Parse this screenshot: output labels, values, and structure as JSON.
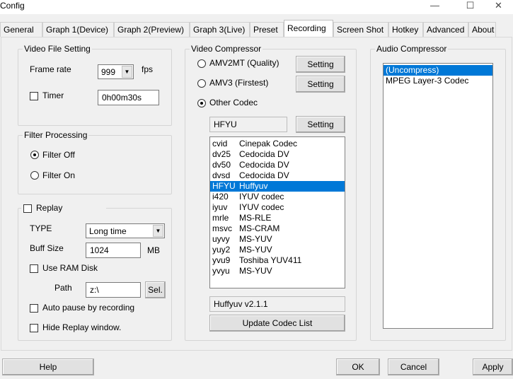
{
  "window": {
    "title": "Config",
    "minimize": "—",
    "maximize": "☐",
    "close": "✕"
  },
  "tabs": [
    "General",
    "Graph 1(Device)",
    "Graph 2(Preview)",
    "Graph 3(Live)",
    "Preset",
    "Recording",
    "Screen Shot",
    "Hotkey",
    "Advanced",
    "About"
  ],
  "active_tab": "Recording",
  "video_file": {
    "group_label": "Video File Setting",
    "frame_rate_label": "Frame rate",
    "frame_rate_value": "999",
    "fps_label": "fps",
    "timer_label": "Timer",
    "timer_checked": false,
    "timer_value": "0h00m30s"
  },
  "filter": {
    "group_label": "Filter Processing",
    "off_label": "Filter Off",
    "on_label": "Filter On",
    "selected": "off"
  },
  "replay": {
    "group_label": "Replay",
    "checked": false,
    "type_label": "TYPE",
    "type_value": "Long time",
    "buff_label": "Buff Size",
    "buff_value": "1024",
    "buff_unit": "MB",
    "ramdisk_label": "Use RAM Disk",
    "path_label": "Path",
    "path_value": "z:\\",
    "sel_label": "Sel.",
    "autopause_label": "Auto pause by recording",
    "hide_label": "Hide Replay window."
  },
  "video_compressor": {
    "group_label": "Video Compressor",
    "options": [
      "AMV2MT (Quality)",
      "AMV3 (Firstest)",
      "Other Codec"
    ],
    "selected_index": 2,
    "setting_label": "Setting",
    "codec_field": "HFYU",
    "codecs": [
      {
        "code": "cvid",
        "name": "Cinepak Codec"
      },
      {
        "code": "dv25",
        "name": "Cedocida DV"
      },
      {
        "code": "dv50",
        "name": "Cedocida DV"
      },
      {
        "code": "dvsd",
        "name": "Cedocida DV"
      },
      {
        "code": "HFYU",
        "name": "Huffyuv"
      },
      {
        "code": "i420",
        "name": "IYUV codec"
      },
      {
        "code": "iyuv",
        "name": "IYUV codec"
      },
      {
        "code": "mrle",
        "name": "MS-RLE"
      },
      {
        "code": "msvc",
        "name": "MS-CRAM"
      },
      {
        "code": "uyvy",
        "name": "MS-YUV"
      },
      {
        "code": "yuy2",
        "name": "MS-YUV"
      },
      {
        "code": "yvu9",
        "name": "Toshiba YUV411"
      },
      {
        "code": "yvyu",
        "name": "MS-YUV"
      }
    ],
    "selected_codec_index": 4,
    "version": "Huffyuv v2.1.1",
    "update_label": "Update Codec List"
  },
  "audio_compressor": {
    "group_label": "Audio Compressor",
    "items": [
      "(Uncompress)",
      "MPEG Layer-3 Codec"
    ],
    "selected_index": 0
  },
  "footer": {
    "help": "Help",
    "ok": "OK",
    "cancel": "Cancel",
    "apply": "Apply"
  },
  "colors": {
    "selection": "#0078d7",
    "background": "#f0f0f0"
  }
}
